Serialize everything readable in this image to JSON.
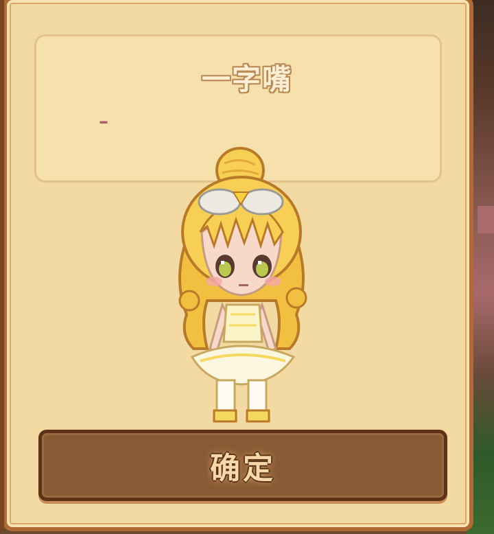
{
  "dialog": {
    "title": "一字嘴",
    "description": "–",
    "confirm_label": "确定"
  },
  "avatar": {
    "icon": "chibi-girl-character",
    "colors": {
      "hair": "#f7c94a",
      "hair_dark": "#c8892a",
      "skin": "#f8d8c8",
      "dress": "#fbf3c8",
      "bow": "#e9e6e0",
      "outline": "#9a6a40"
    }
  },
  "colors": {
    "panel_bg": "#f3d9a2",
    "panel_border": "#b06a36",
    "button_bg": "#8a5a34",
    "button_text": "#f8d7a9"
  }
}
